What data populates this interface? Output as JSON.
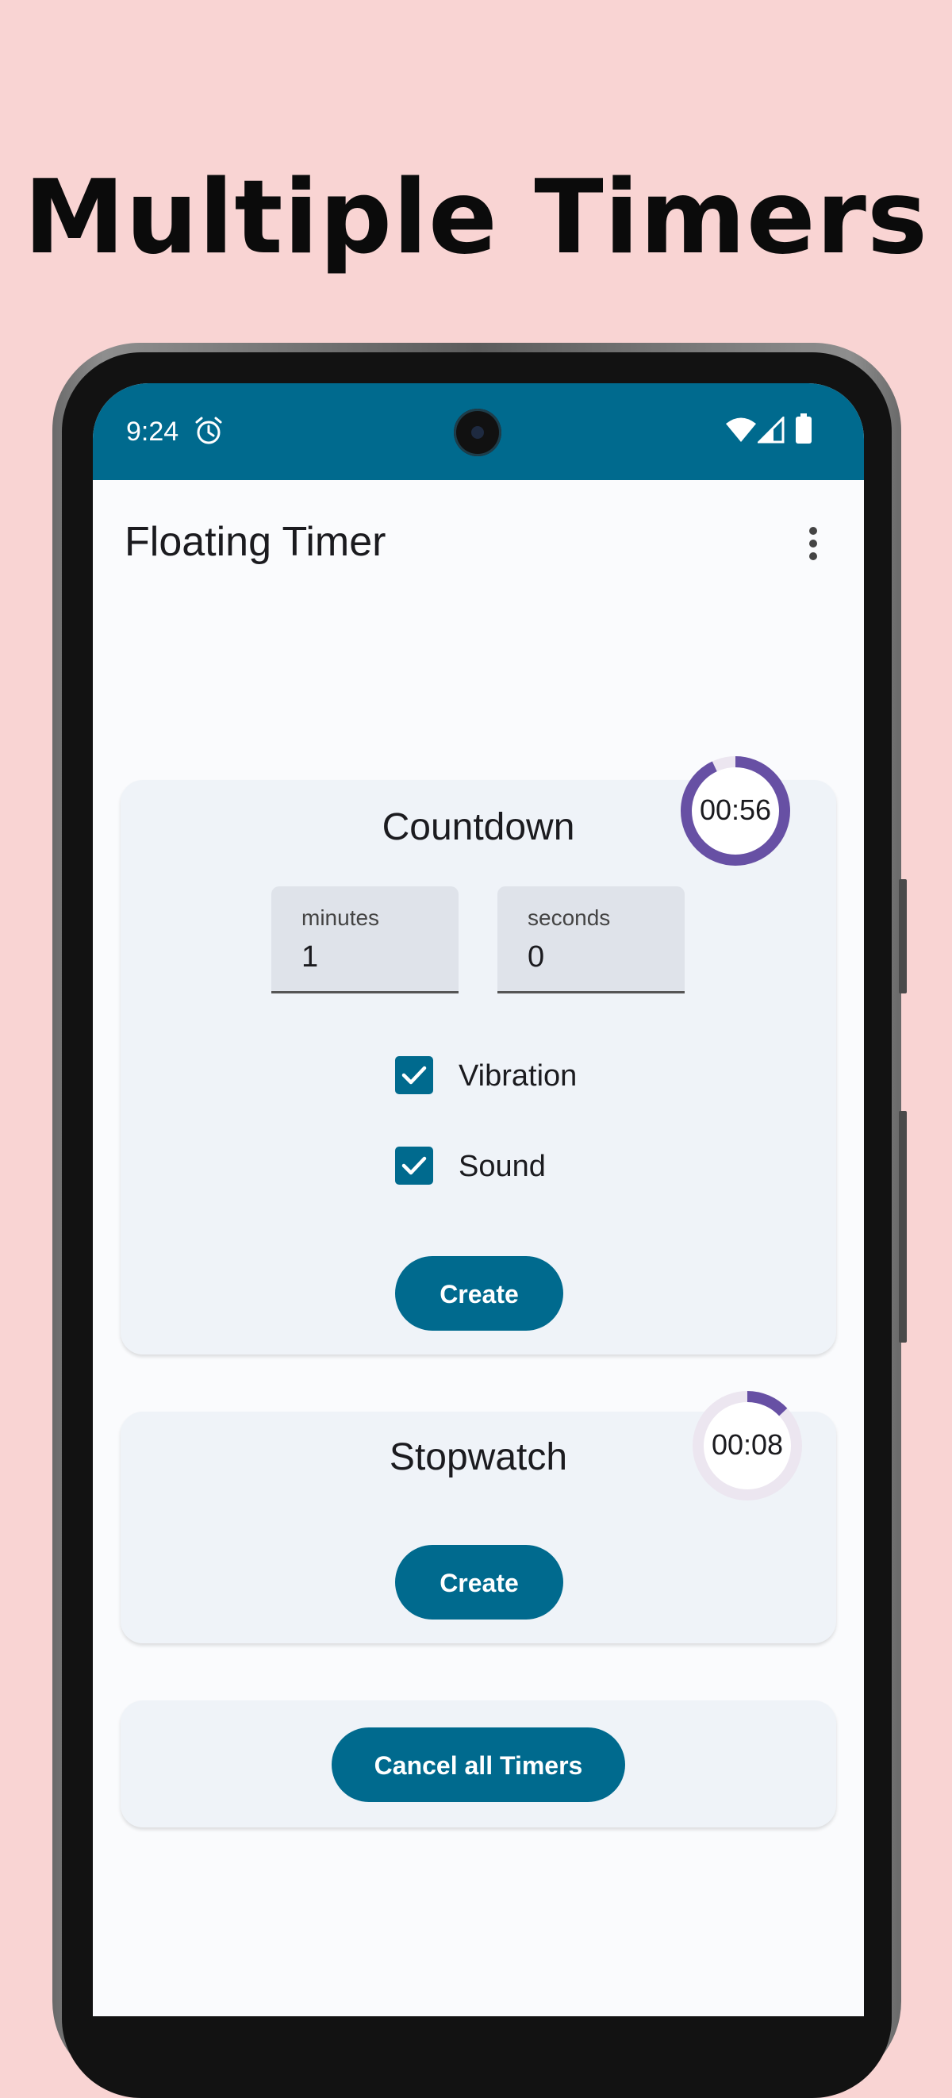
{
  "headline": "Multiple Timers",
  "status_bar": {
    "time": "9:24",
    "icons": [
      "alarm-icon",
      "wifi-icon",
      "signal-icon",
      "battery-icon"
    ]
  },
  "app_bar": {
    "title": "Floating Timer",
    "menu_icon": "more-vert-icon"
  },
  "countdown_card": {
    "title": "Countdown",
    "minutes": {
      "label": "minutes",
      "value": "1"
    },
    "seconds": {
      "label": "seconds",
      "value": "0"
    },
    "vibration": {
      "label": "Vibration",
      "checked": true
    },
    "sound": {
      "label": "Sound",
      "checked": true
    },
    "create_label": "Create",
    "floating_timer": {
      "time": "00:56",
      "progress": 0.93
    }
  },
  "stopwatch_card": {
    "title": "Stopwatch",
    "create_label": "Create",
    "floating_timer": {
      "time": "00:08",
      "progress": 0.13
    }
  },
  "cancel_card": {
    "cancel_label": "Cancel all Timers"
  },
  "colors": {
    "background": "#f9d4d3",
    "primary": "#006a8e",
    "ring": "#6750a4",
    "ring_track": "#ece6f0",
    "card": "#eff3f8"
  }
}
